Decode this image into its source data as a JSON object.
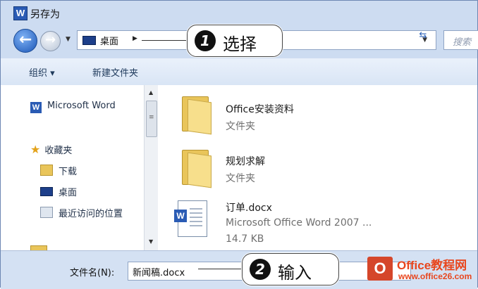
{
  "window": {
    "title": "另存为",
    "title_icon": "W"
  },
  "address_bar": {
    "location": "桌面",
    "search_placeholder": "搜索"
  },
  "toolbar": {
    "organize": "组织 ▾",
    "new_folder": "新建文件夹"
  },
  "nav_pane": {
    "items": [
      {
        "label": "Microsoft Word",
        "icon": "word-icon"
      },
      {
        "label": "收藏夹",
        "icon": "star-icon"
      },
      {
        "label": "下载",
        "icon": "download-folder-icon"
      },
      {
        "label": "桌面",
        "icon": "desktop-icon"
      },
      {
        "label": "最近访问的位置",
        "icon": "recent-places-icon"
      }
    ]
  },
  "files": [
    {
      "name": "Office安装资料",
      "type": "文件夹",
      "icon": "folder-icon"
    },
    {
      "name": "规划求解",
      "type": "文件夹",
      "icon": "folder-icon"
    },
    {
      "name": "订单.docx",
      "type": "Microsoft Office Word 2007 ...",
      "size": "14.7 KB",
      "icon": "word-document-icon"
    }
  ],
  "filename": {
    "label": "文件名(N):",
    "value": "新闻稿.docx"
  },
  "callouts": [
    {
      "number": "1",
      "text": "选择"
    },
    {
      "number": "2",
      "text": "输入"
    }
  ],
  "watermark": {
    "logo": "O",
    "line1": "Office教程网",
    "line2": "www.office26.com"
  },
  "colors": {
    "accent": "#2a5bb4",
    "callout_border": "#444444",
    "watermark": "#e8461e"
  }
}
